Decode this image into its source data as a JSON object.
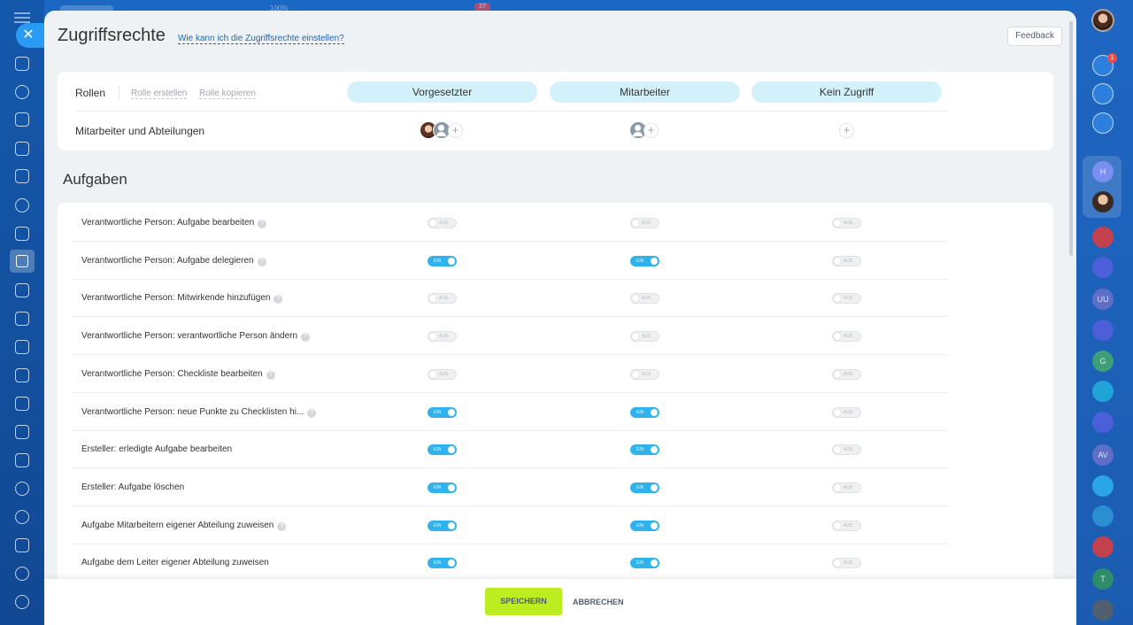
{
  "background_ghost": {
    "zoom": "100%",
    "badge": "27"
  },
  "header": {
    "title": "Zugriffsrechte",
    "help_link": "Wie kann ich die Zugriffsrechte einstellen?",
    "feedback": "Feedback"
  },
  "roles": {
    "label": "Rollen",
    "create_link": "Rolle erstellen",
    "copy_link": "Rolle kopieren",
    "columns": [
      "Vorgesetzter",
      "Mitarbeiter",
      "Kein Zugriff"
    ],
    "members_label": "Mitarbeiter und Abteilungen",
    "add_symbol": "+"
  },
  "section": {
    "title": "Aufgaben"
  },
  "toggle_text": {
    "on": "EIN",
    "off": "AUS"
  },
  "help_symbol": "?",
  "permissions": [
    {
      "label": "Verantwortliche Person: Aufgabe bearbeiten",
      "help": true,
      "values": [
        false,
        false,
        false
      ]
    },
    {
      "label": "Verantwortliche Person: Aufgabe delegieren",
      "help": true,
      "values": [
        true,
        true,
        false
      ]
    },
    {
      "label": "Verantwortliche Person: Mitwirkende hinzufügen",
      "help": true,
      "values": [
        false,
        false,
        false
      ]
    },
    {
      "label": "Verantwortliche Person: verantwortliche Person ändern",
      "help": true,
      "values": [
        false,
        false,
        false
      ]
    },
    {
      "label": "Verantwortliche Person: Checkliste bearbeiten",
      "help": true,
      "values": [
        false,
        false,
        false
      ]
    },
    {
      "label": "Verantwortliche Person: neue Punkte zu Checklisten hi...",
      "help": true,
      "values": [
        true,
        true,
        false
      ]
    },
    {
      "label": "Ersteller: erledigte Aufgabe bearbeiten",
      "help": false,
      "values": [
        true,
        true,
        false
      ]
    },
    {
      "label": "Ersteller: Aufgabe löschen",
      "help": false,
      "values": [
        true,
        true,
        false
      ]
    },
    {
      "label": "Aufgabe Mitarbeitern eigener Abteilung zuweisen",
      "help": true,
      "values": [
        true,
        true,
        false
      ]
    },
    {
      "label": "Aufgabe dem Leiter eigener Abteilung zuweisen",
      "help": false,
      "values": [
        true,
        true,
        false
      ]
    }
  ],
  "footer": {
    "save": "SPEICHERN",
    "cancel": "ABBRECHEN"
  },
  "close_symbol": "✕",
  "right_sidebar": {
    "notification_count": "1",
    "letters": [
      "H",
      "UU",
      "G",
      "AV",
      "T"
    ]
  },
  "colors": {
    "accent_blue": "#2fb3ef",
    "role_pill": "#d3f1fb",
    "save_button": "#bbed21",
    "link": "#2066b0"
  }
}
